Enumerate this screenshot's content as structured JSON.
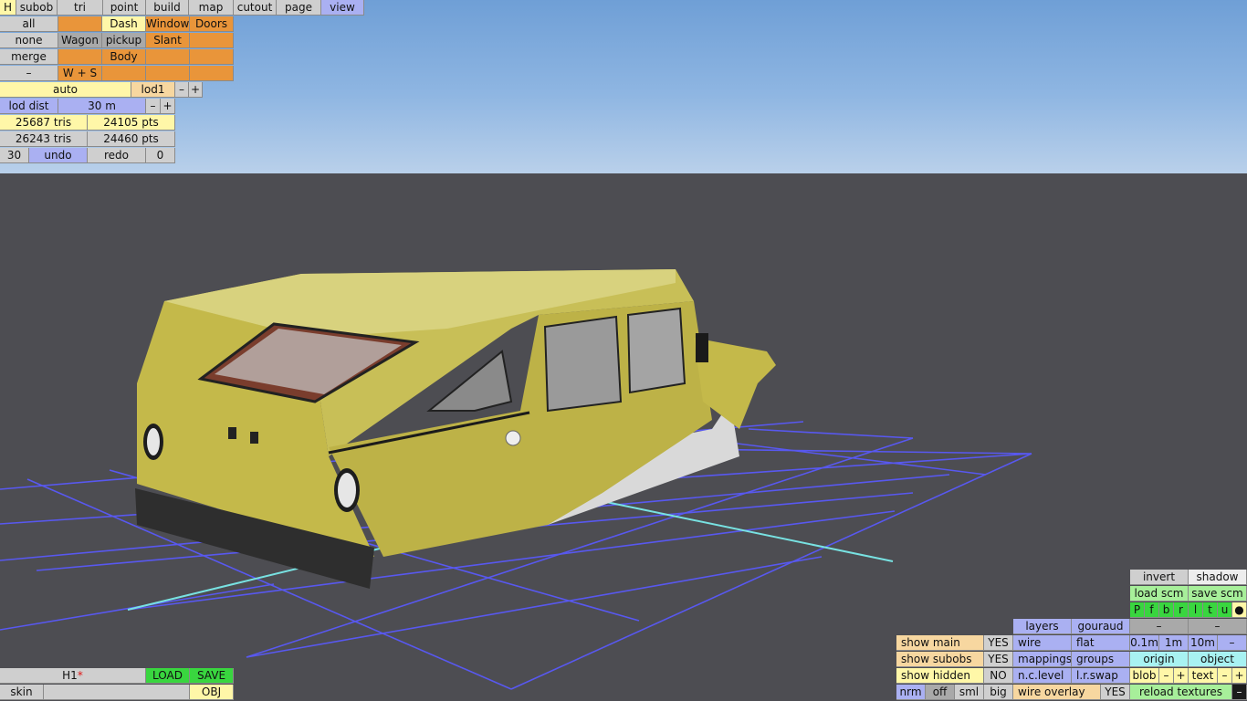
{
  "menu": {
    "h": "H",
    "tabs": [
      "subob",
      "tri",
      "point",
      "build",
      "map",
      "cutout",
      "page",
      "view"
    ],
    "active_tab": "view"
  },
  "subobs": {
    "all": "all",
    "none": "none",
    "merge": "merge",
    "minus": "–",
    "dash": "Dash",
    "windows": "Windows",
    "doors": "Doors",
    "wagon": "Wagon",
    "pickup": "pickup",
    "slant": "Slant",
    "body": "Body",
    "ws": "W + S"
  },
  "lod": {
    "auto": "auto",
    "level": "lod1",
    "minus": "–",
    "plus": "+",
    "dist_label": "lod dist",
    "dist_value": "30 m"
  },
  "stats": {
    "tris_1": "25687 tris",
    "pts_1": "24105 pts",
    "tris_2": "26243 tris",
    "pts_2": "24460 pts"
  },
  "undo": {
    "count": "30",
    "undo": "undo",
    "redo": "redo",
    "redo_count": "0"
  },
  "right_panel": {
    "invert": "invert",
    "shadow": "shadow",
    "load_scm": "load scm",
    "save_scm": "save scm",
    "letters": [
      "P",
      "f",
      "b",
      "r",
      "l",
      "t",
      "u",
      "●"
    ],
    "layers": "layers",
    "gouraud": "gouraud",
    "dash": "–",
    "wire": "wire",
    "flat": "flat",
    "mappings": "mappings",
    "groups": "groups",
    "nclevel": "n.c.level",
    "lrswap": "l.r.swap",
    "wire_overlay": "wire overlay",
    "yes": "YES",
    "no": "NO",
    "grid": [
      "0.1m",
      "1m",
      "10m",
      "–"
    ],
    "origin": "origin",
    "object": "object",
    "blob": "blob",
    "text": "text",
    "reload_textures": "reload textures",
    "show_main": "show main",
    "show_subobs": "show subobs",
    "show_hidden": "show hidden",
    "nrm": "nrm",
    "off": "off",
    "sml": "sml",
    "big": "big",
    "minus": "–",
    "plus": "+"
  },
  "file": {
    "name": "H1",
    "modified_mark": "*",
    "load": "LOAD",
    "save": "SAVE",
    "skin": "skin",
    "skin_value": "",
    "obj": "OBJ"
  },
  "colors": {
    "sky": "#8fb6e2",
    "ground": "#4d4d52",
    "grid": "#5a5aff",
    "axis": "#7fe8e8",
    "body": "#c4b94a",
    "roof": "#d6cf7a",
    "bumper": "#2e2e2e"
  }
}
